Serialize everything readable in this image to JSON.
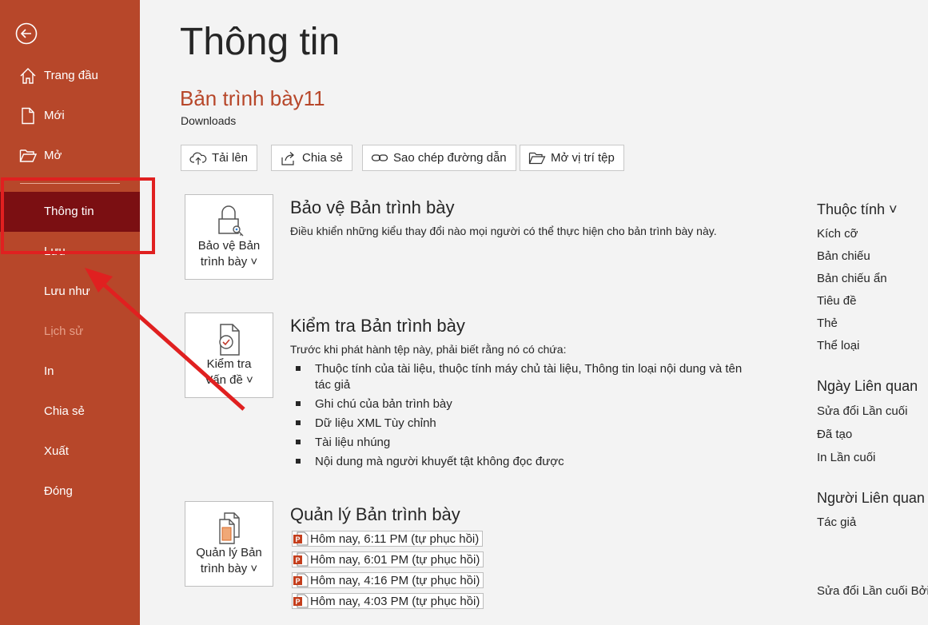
{
  "sidebar": {
    "items": [
      {
        "label": "Trang đầu",
        "icon": "home-icon"
      },
      {
        "label": "Mới",
        "icon": "new-document-icon"
      },
      {
        "label": "Mở",
        "icon": "open-folder-icon"
      },
      {
        "label": "Thông tin"
      },
      {
        "label": "Lưu"
      },
      {
        "label": "Lưu như"
      },
      {
        "label": "Lịch sử"
      },
      {
        "label": "In"
      },
      {
        "label": "Chia sẻ"
      },
      {
        "label": "Xuất"
      },
      {
        "label": "Đóng"
      }
    ],
    "active_item": "Thông tin",
    "disabled_item": "Lịch sử"
  },
  "main": {
    "title": "Thông tin",
    "document_name": "Bản trình bày11",
    "location": "Downloads",
    "toolbar": {
      "upload": "Tải lên",
      "share": "Chia sẻ",
      "copy_path": "Sao chép đường dẫn",
      "open_location": "Mở vị trí tệp"
    },
    "protect": {
      "button_line1": "Bảo vệ Bản",
      "button_line2": "trình bày ˅",
      "title": "Bảo vệ Bản trình bày",
      "description": "Điều khiển những kiểu thay đổi nào mọi người có thể thực hiện cho bản trình bày này."
    },
    "inspect": {
      "button_line1": "Kiểm tra",
      "button_line2": "Vấn đề ˅",
      "title": "Kiểm tra Bản trình bày",
      "description": "Trước khi phát hành tệp này, phải biết rằng nó có chứa:",
      "bullets": [
        "Thuộc tính của tài liệu, thuộc tính máy chủ tài liệu, Thông tin loại nội dung và tên tác giả",
        "Ghi chú của bản trình bày",
        "Dữ liệu XML Tùy chỉnh",
        "Tài liệu nhúng",
        "Nội dung mà người khuyết tật không đọc được"
      ]
    },
    "manage": {
      "button_line1": "Quản lý Bản",
      "button_line2": "trình bày ˅",
      "title": "Quản lý Bản trình bày",
      "versions": [
        "Hôm nay, 6:11 PM (tự phục hồi)",
        "Hôm nay, 6:01 PM (tự phục hồi)",
        "Hôm nay, 4:16 PM (tự phục hồi)",
        "Hôm nay, 4:03 PM (tự phục hồi)"
      ]
    }
  },
  "properties": {
    "heading": "Thuộc tính ˅",
    "items": [
      "Kích cỡ",
      "Bản chiếu",
      "Bản chiếu ẩn",
      "Tiêu đề",
      "Thẻ",
      "Thể loại"
    ],
    "dates_heading": "Ngày Liên quan",
    "dates": [
      "Sửa đổi Lần cuối",
      "Đã tạo",
      "In Lần cuối"
    ],
    "people_heading": "Người Liên quan",
    "people": [
      "Tác giả"
    ],
    "last_modified_by": "Sửa đổi Lần cuối Bởi"
  },
  "colors": {
    "accent": "#b7472a",
    "active_nav": "#7b0f12",
    "annotation": "#e02020"
  }
}
